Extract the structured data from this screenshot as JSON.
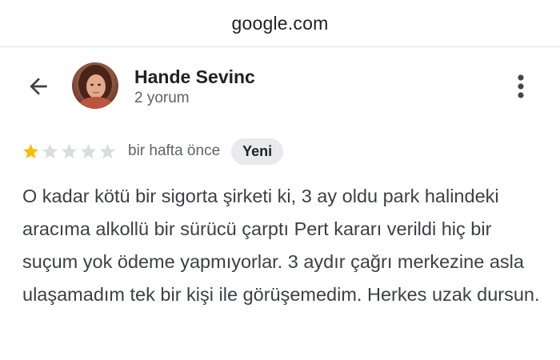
{
  "browser": {
    "url": "google.com"
  },
  "reviewer": {
    "name": "Hande Sevinc",
    "review_count": "2 yorum",
    "avatar_icon": "profile-photo"
  },
  "review": {
    "rating": 1,
    "rating_max": 5,
    "time": "bir hafta önce",
    "badge": "Yeni",
    "text": "O kadar kötü bir sigorta şirketi ki, 3 ay oldu park halindeki aracıma alkollü bir sürücü çarptı Pert kararı verildi hiç bir suçum yok ödeme yapmıyorlar. 3 aydır çağrı merkezine asla ulaşamadım tek bir kişi ile görüşemedim. Herkes uzak dursun."
  },
  "icons": {
    "back": "arrow-left-icon",
    "more": "more-vert-icon",
    "star_filled": "star-filled-icon",
    "star_empty": "star-empty-icon"
  },
  "colors": {
    "star_filled": "#fbbc04",
    "star_empty": "#dadce0",
    "badge_bg": "#e8eaed",
    "secondary_text": "#5f6368"
  }
}
